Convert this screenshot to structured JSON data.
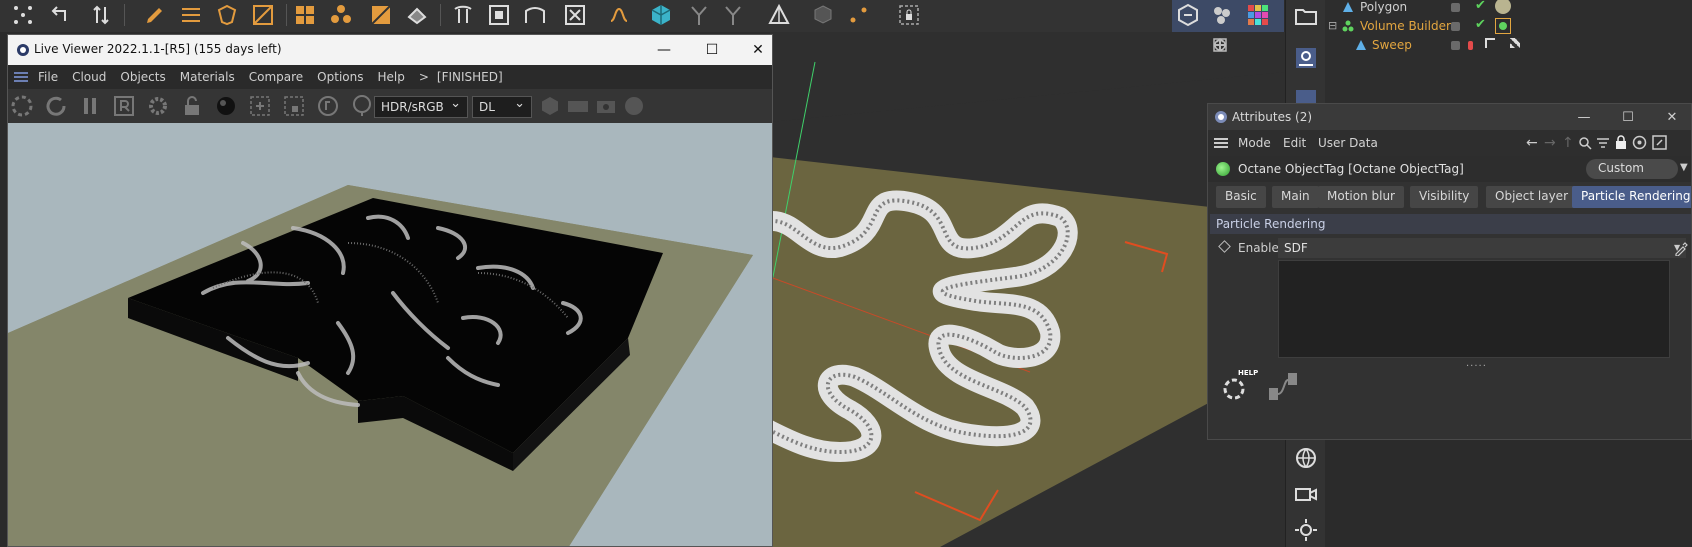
{
  "live_viewer": {
    "title": "Live Viewer 2022.1.1-[R5] (155 days left)",
    "menu": [
      "File",
      "Cloud",
      "Objects",
      "Materials",
      "Compare",
      "Options",
      "Help"
    ],
    "status_arrow": ">",
    "status": "[FINISHED]",
    "tonemap_select": "HDR/sRGB",
    "kernel_select": "DL",
    "btn_minimize": "—",
    "btn_maximize": "☐",
    "btn_close": "✕"
  },
  "object_manager": {
    "items": [
      {
        "name": "Polygon",
        "color": "#d0d0d0"
      },
      {
        "name": "Volume Builder",
        "color": "#e3a640"
      },
      {
        "name": "Sweep",
        "color": "#e3a640"
      }
    ],
    "tree_toggle": "⊟"
  },
  "attributes": {
    "title": "Attributes (2)",
    "menu": [
      "Mode",
      "Edit",
      "User Data"
    ],
    "object_name": "Octane ObjectTag [Octane ObjectTag]",
    "layout_select": "Custom",
    "tabs": [
      "Basic",
      "Main",
      "Motion blur",
      "Visibility",
      "Object layer",
      "Particle Rendering"
    ],
    "active_tab": "Particle Rendering",
    "section_title": "Particle Rendering",
    "enable_label": "Enable",
    "enable_value": "SDF",
    "grip": ".....",
    "help_badge": "HELP",
    "btn_minimize": "—",
    "btn_maximize": "☐",
    "btn_close": "✕"
  },
  "colors": {
    "accent": "#4a5d8a",
    "ground_viewport": "#6b6540",
    "render_sky": "#a9b7bd",
    "render_ground": "#84866a"
  }
}
